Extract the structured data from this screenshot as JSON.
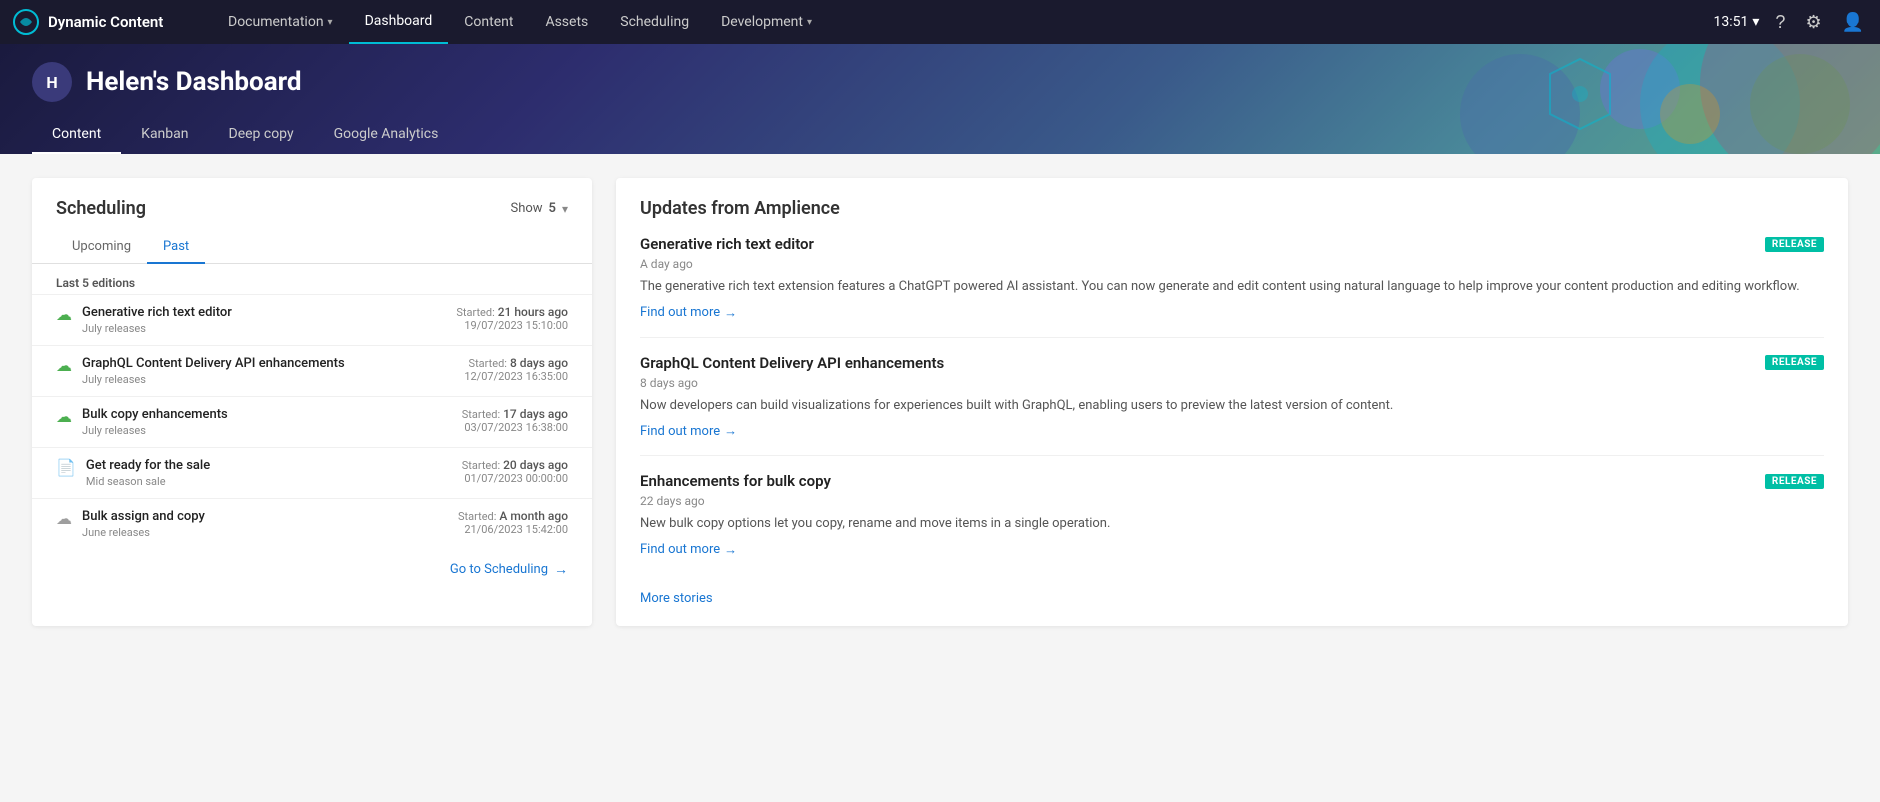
{
  "app": {
    "logo_letter": "●",
    "title": "Dynamic Content"
  },
  "topnav": {
    "links": [
      {
        "label": "Documentation",
        "has_chevron": true,
        "active": false,
        "name": "documentation"
      },
      {
        "label": "Dashboard",
        "has_chevron": false,
        "active": true,
        "name": "dashboard"
      },
      {
        "label": "Content",
        "has_chevron": false,
        "active": false,
        "name": "content"
      },
      {
        "label": "Assets",
        "has_chevron": false,
        "active": false,
        "name": "assets"
      },
      {
        "label": "Scheduling",
        "has_chevron": false,
        "active": false,
        "name": "scheduling"
      },
      {
        "label": "Development",
        "has_chevron": true,
        "active": false,
        "name": "development"
      }
    ],
    "time": "13:51",
    "time_chevron": "▾"
  },
  "dashboard": {
    "avatar_letter": "H",
    "title": "Helen's Dashboard",
    "tabs": [
      {
        "label": "Content",
        "active": true,
        "name": "tab-content"
      },
      {
        "label": "Kanban",
        "active": false,
        "name": "tab-kanban"
      },
      {
        "label": "Deep copy",
        "active": false,
        "name": "tab-deep-copy"
      },
      {
        "label": "Google Analytics",
        "active": false,
        "name": "tab-google-analytics"
      }
    ]
  },
  "scheduling": {
    "title": "Scheduling",
    "show_label": "Show",
    "show_count": "5",
    "tabs": [
      {
        "label": "Upcoming",
        "active": false,
        "name": "tab-upcoming"
      },
      {
        "label": "Past",
        "active": true,
        "name": "tab-past"
      }
    ],
    "editions_label": "Last 5 editions",
    "editions": [
      {
        "icon_type": "cloud-green",
        "name": "Generative rich text editor",
        "sub": "July releases",
        "started_label": "Started:",
        "time_ago": "21 hours ago",
        "datetime": "19/07/2023 15:10:00"
      },
      {
        "icon_type": "cloud-green",
        "name": "GraphQL Content Delivery API enhancements",
        "sub": "July releases",
        "started_label": "Started:",
        "time_ago": "8 days ago",
        "datetime": "12/07/2023 16:35:00"
      },
      {
        "icon_type": "cloud-green",
        "name": "Bulk copy enhancements",
        "sub": "July releases",
        "started_label": "Started:",
        "time_ago": "17 days ago",
        "datetime": "03/07/2023 16:38:00"
      },
      {
        "icon_type": "doc",
        "name": "Get ready for the sale",
        "sub": "Mid season sale",
        "started_label": "Started:",
        "time_ago": "20 days ago",
        "datetime": "01/07/2023 00:00:00"
      },
      {
        "icon_type": "cloud-gray",
        "name": "Bulk assign and copy",
        "sub": "June releases",
        "started_label": "Started:",
        "time_ago": "A month ago",
        "datetime": "21/06/2023 15:42:00"
      }
    ],
    "go_scheduling_label": "Go to Scheduling",
    "go_arrow": "→"
  },
  "updates": {
    "title": "Updates from Amplience",
    "cards": [
      {
        "title": "Generative rich text editor",
        "badge": "RELEASE",
        "age": "A day ago",
        "description": "The generative rich text extension features a ChatGPT powered AI assistant. You can now generate and edit content using natural language to help improve your content production and editing workflow.",
        "find_more_label": "Find out more",
        "arrow": "→"
      },
      {
        "title": "GraphQL Content Delivery API enhancements",
        "badge": "RELEASE",
        "age": "8 days ago",
        "description": "Now developers can build visualizations for experiences built with GraphQL, enabling users to preview the latest version of content.",
        "find_more_label": "Find out more",
        "arrow": "→"
      },
      {
        "title": "Enhancements for bulk copy",
        "badge": "RELEASE",
        "age": "22 days ago",
        "description": "New bulk copy options let you copy, rename and move items in a single operation.",
        "find_more_label": "Find out more",
        "arrow": "→"
      }
    ],
    "more_stories_label": "More stories"
  }
}
